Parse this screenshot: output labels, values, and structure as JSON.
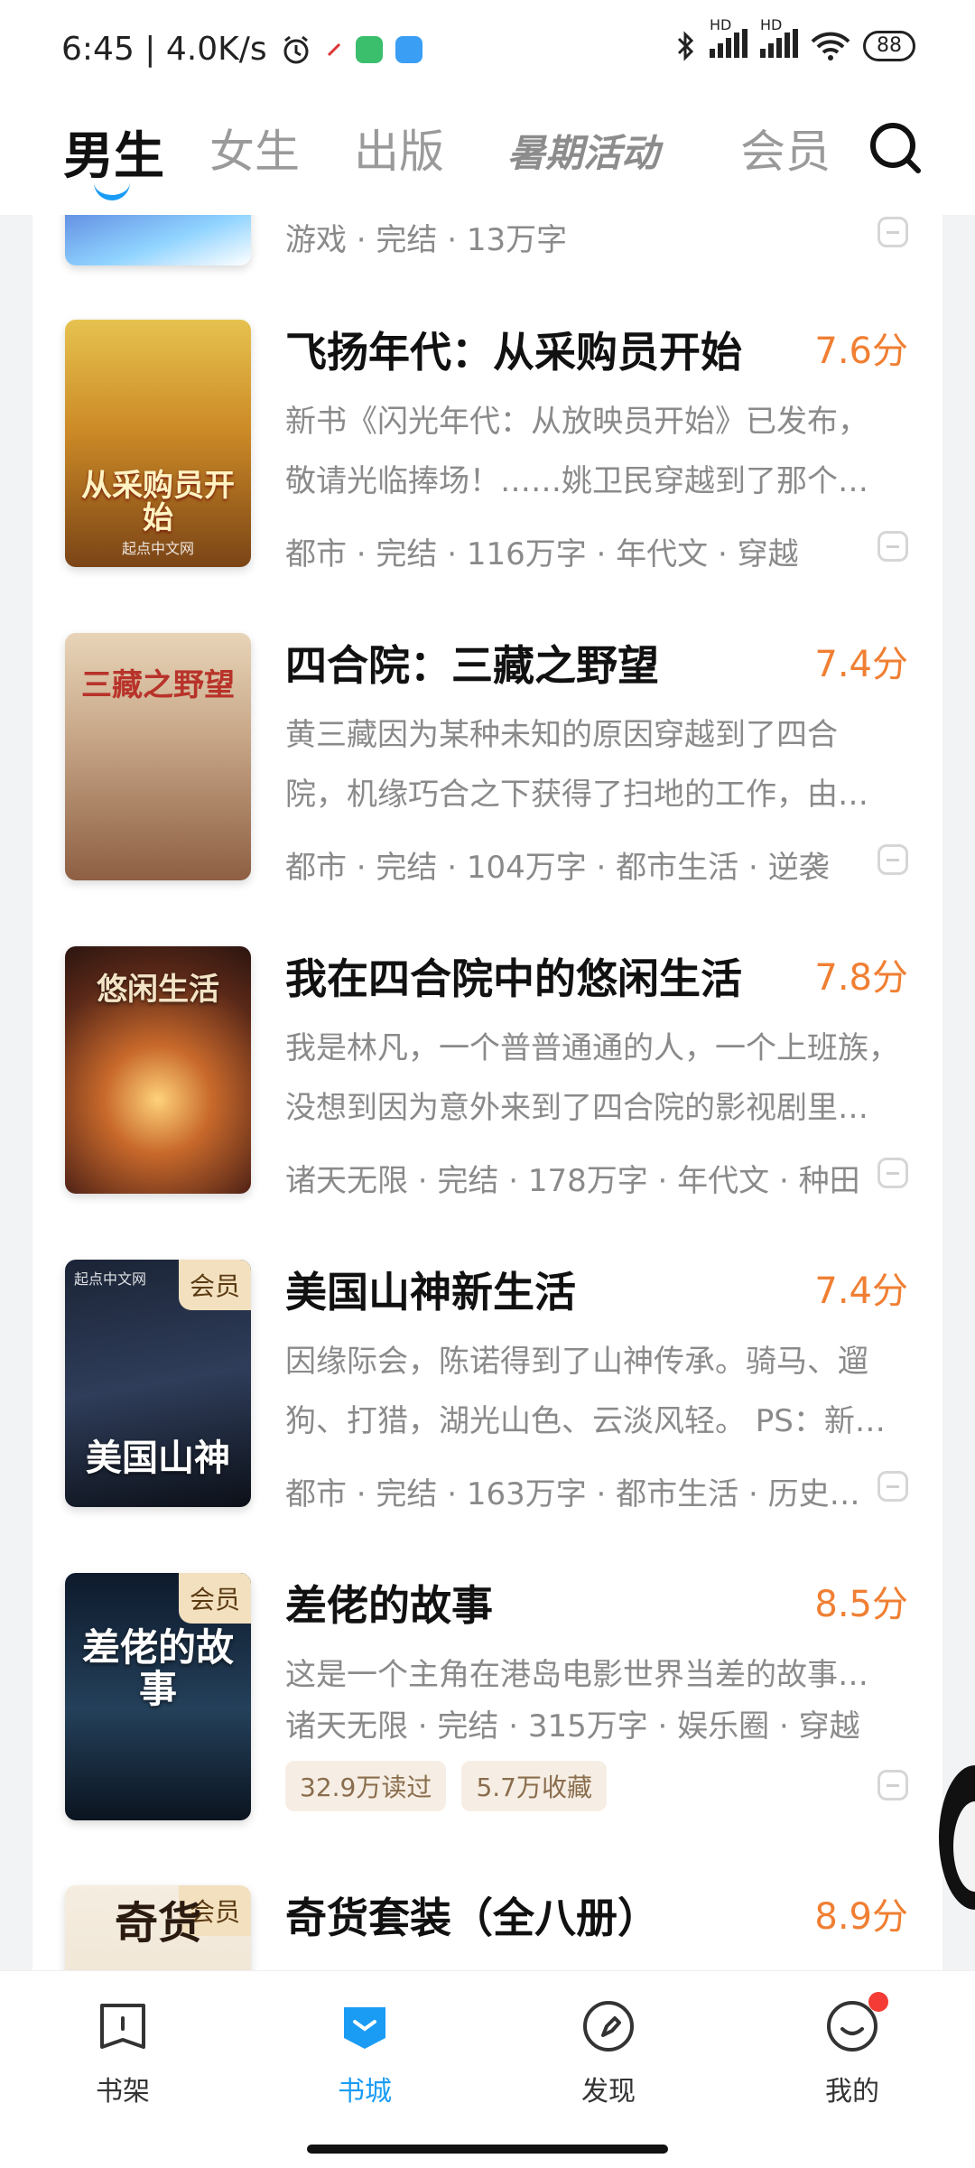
{
  "status_bar": {
    "time_speed": "6:45 | 4.0K/s",
    "battery": "88",
    "network": [
      "HD",
      "HD"
    ],
    "icons": [
      "alarm-icon",
      "arrow-icon",
      "shield-app-icon",
      "cloud-app-icon",
      "bluetooth-icon",
      "wifi-icon"
    ]
  },
  "top_tabs": [
    {
      "label": "男生",
      "active": true
    },
    {
      "label": "女生",
      "active": false
    },
    {
      "label": "出版",
      "active": false
    },
    {
      "label": "暑期活动",
      "active": false
    },
    {
      "label": "会员",
      "active": false
    }
  ],
  "partial_book": {
    "meta": "游戏 · 完结 · 13万字"
  },
  "books": [
    {
      "title": "飞扬年代：从采购员开始",
      "score": "7.6分",
      "desc": [
        "新书《闪光年代：从放映员开始》已发布，",
        "敬请光临捧场！……姚卫民穿越到了那个…"
      ],
      "meta": "都市 · 完结 · 116万字 · 年代文 · 穿越",
      "cover_title": "从采购员开始",
      "cover_publisher": "起点中文网"
    },
    {
      "title": "四合院：三藏之野望",
      "score": "7.4分",
      "desc": [
        "黄三藏因为某种未知的原因穿越到了四合",
        "院，机缘巧合之下获得了扫地的工作，由…"
      ],
      "meta": "都市 · 完结 · 104万字 · 都市生活 · 逆袭",
      "cover_title": "三藏之野望"
    },
    {
      "title": "我在四合院中的悠闲生活",
      "score": "7.8分",
      "desc": [
        "我是林凡，一个普普通通的人，一个上班族，",
        "没想到因为意外来到了四合院的影视剧里…"
      ],
      "meta": "诸天无限 · 完结 · 178万字 · 年代文 · 种田",
      "cover_title": "悠闲生活"
    },
    {
      "title": "美国山神新生活",
      "score": "7.4分",
      "desc": [
        "因缘际会，陈诺得到了山神传承。骑马、遛",
        "狗、打猎，湖光山色、云淡风轻。 PS：新…"
      ],
      "meta": "都市 · 完结 · 163万字 · 都市生活 · 历史…",
      "cover_title": "美国山神",
      "cover_publisher": "起点中文网",
      "vip": "会员"
    },
    {
      "title": "差佬的故事",
      "score": "8.5分",
      "desc": [
        "这是一个主角在港岛电影世界当差的故事…"
      ],
      "meta": "诸天无限 · 完结 · 315万字 · 娱乐圈 · 穿越",
      "stats": [
        "32.9万读过",
        "5.7万收藏"
      ],
      "cover_title": "差佬的故事",
      "vip": "会员"
    },
    {
      "title": "奇货套装（全八册）",
      "score": "8.9分",
      "cover_title": "奇货",
      "vip": "会员"
    }
  ],
  "bottom_nav": [
    {
      "label": "书架",
      "icon": "bookshelf-icon",
      "active": false
    },
    {
      "label": "书城",
      "icon": "bookstore-icon",
      "active": true
    },
    {
      "label": "发现",
      "icon": "compass-icon",
      "active": false
    },
    {
      "label": "我的",
      "icon": "profile-icon",
      "active": false,
      "badge": true
    }
  ],
  "colors": {
    "accent": "#1a9cf5",
    "score": "#f07f33",
    "badge": "#f43b35"
  }
}
